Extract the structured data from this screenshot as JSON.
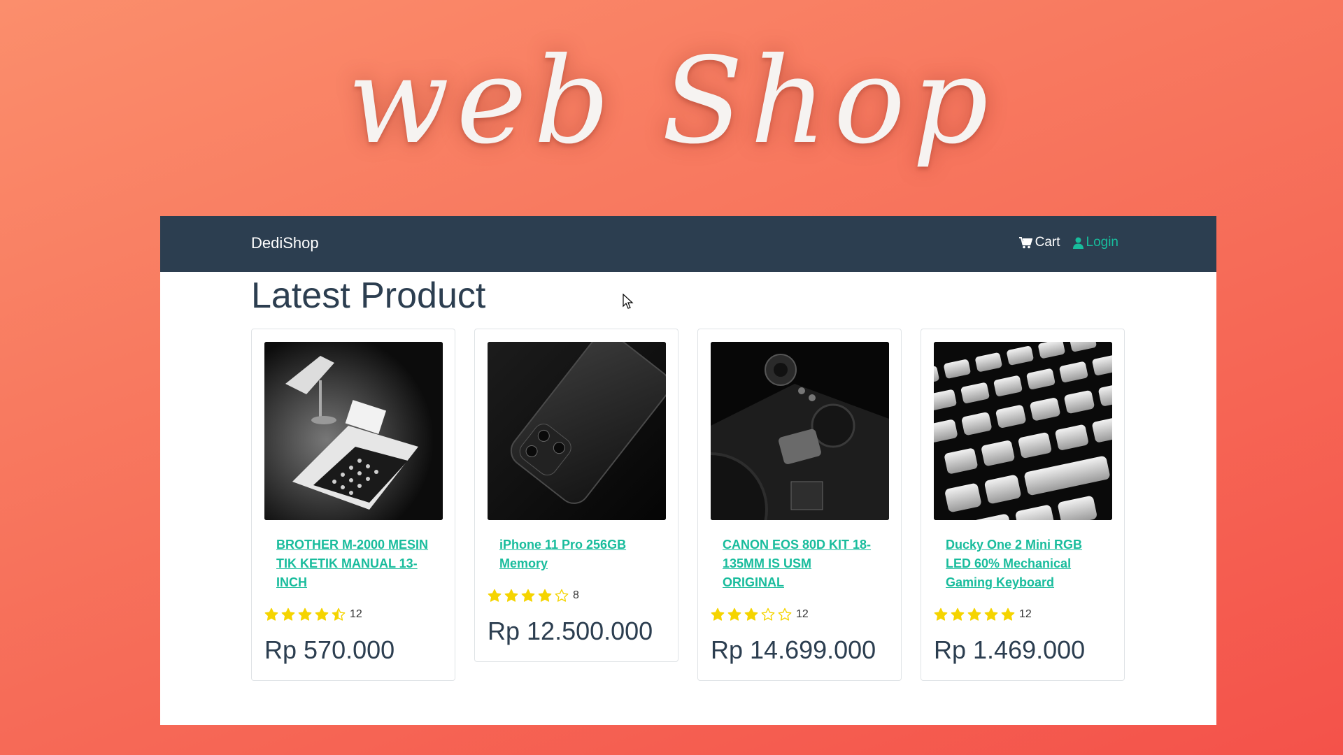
{
  "banner": {
    "title": "web Shop"
  },
  "navbar": {
    "brand": "DediShop",
    "links": [
      {
        "label": "Cart",
        "icon": "cart-icon"
      },
      {
        "label": "Login",
        "icon": "user-icon"
      }
    ]
  },
  "main": {
    "title": "Latest Product",
    "products": [
      {
        "name": "BROTHER M-2000 MESIN TIK KETIK MANUAL 13-INCH",
        "rating": 4.5,
        "reviews": "12",
        "price": "Rp 570.000",
        "image": "typewriter-image"
      },
      {
        "name": "iPhone 11 Pro 256GB Memory",
        "rating": 4,
        "reviews": "8",
        "price": "Rp 12.500.000",
        "image": "phone-image"
      },
      {
        "name": "CANON EOS 80D KIT 18-135MM IS USM ORIGINAL",
        "rating": 3,
        "reviews": "12",
        "price": "Rp 14.699.000",
        "image": "camera-image"
      },
      {
        "name": "Ducky One 2 Mini RGB LED 60% Mechanical Gaming Keyboard",
        "rating": 5,
        "reviews": "12",
        "price": "Rp 1.469.000",
        "image": "keyboard-image"
      }
    ]
  },
  "colors": {
    "navbar": "#2c3e50",
    "accent": "#18bc9c",
    "star": "#f5d400"
  }
}
